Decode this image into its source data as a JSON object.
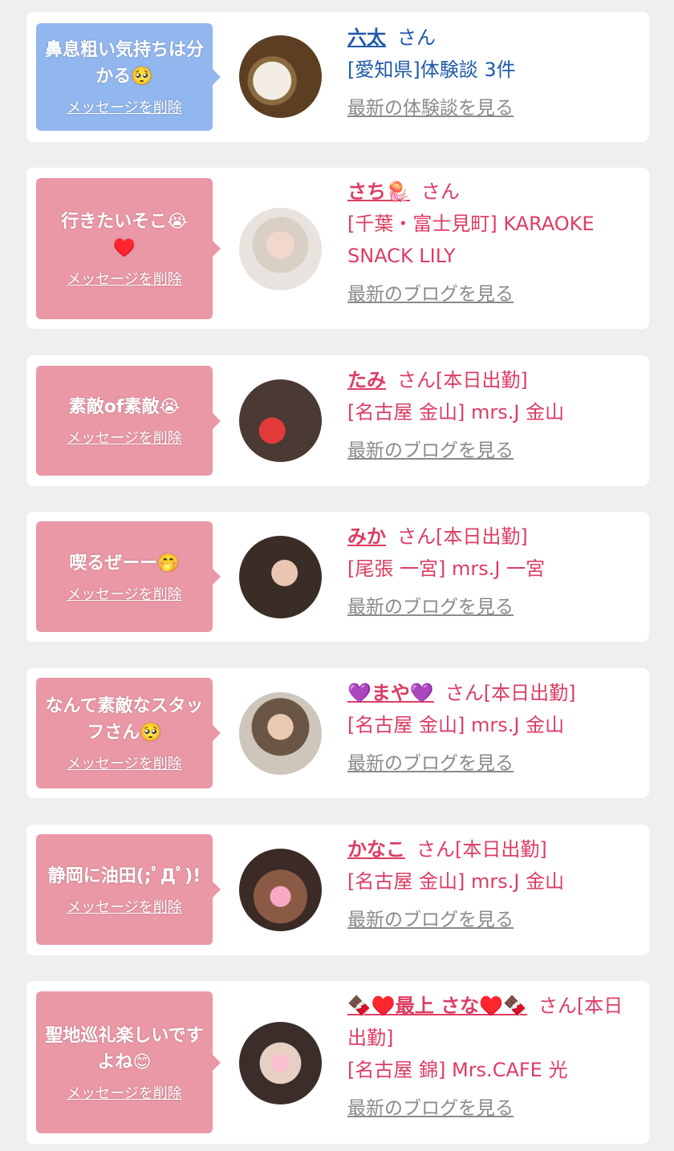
{
  "delete_label": "メッセージを削除",
  "colors": {
    "blue_bubble": "#92b6ee",
    "pink_bubble": "#ea98a6",
    "blue_text": "#1f5aa8",
    "pink_text": "#dc3d63",
    "link_gray": "#8a8a8a"
  },
  "items": [
    {
      "message": "鼻息粗い気持ちは分かる🥺",
      "name": "六太",
      "suffix": "さん",
      "shop": "[愛知県]体験談 3件",
      "link": "最新の体験談を見る",
      "theme": "blue"
    },
    {
      "message": "行きたいそこ😭♥️",
      "name": "さち🪼",
      "suffix": "さん",
      "shop": "[千葉・富士見町] KARAOKE SNACK LILY",
      "link": "最新のブログを見る",
      "theme": "pink"
    },
    {
      "message": "素敵of素敵😭",
      "name": "たみ",
      "suffix": "さん[本日出勤]",
      "shop": "[名古屋 金山] mrs.J 金山",
      "link": "最新のブログを見る",
      "theme": "pink"
    },
    {
      "message": "喫るぜーー🤭",
      "name": "みか",
      "suffix": "さん[本日出勤]",
      "shop": "[尾張 一宮] mrs.J 一宮",
      "link": "最新のブログを見る",
      "theme": "pink"
    },
    {
      "message": "なんて素敵なスタッフさん🥺",
      "name": "💜まや💜",
      "suffix": "さん[本日出勤]",
      "shop": "[名古屋 金山] mrs.J 金山",
      "link": "最新のブログを見る",
      "theme": "pink"
    },
    {
      "message": "静岡に油田(;ﾟДﾟ)!",
      "name": "かなこ",
      "suffix": "さん[本日出勤]",
      "shop": "[名古屋 金山] mrs.J 金山",
      "link": "最新のブログを見る",
      "theme": "pink"
    },
    {
      "message": "聖地巡礼楽しいですよね😊",
      "name": "🍫♥️最上 さな♥️🍫",
      "suffix": "さん[本日出勤]",
      "shop": "[名古屋 錦] Mrs.CAFE 光",
      "link": "最新のブログを見る",
      "theme": "pink"
    }
  ]
}
